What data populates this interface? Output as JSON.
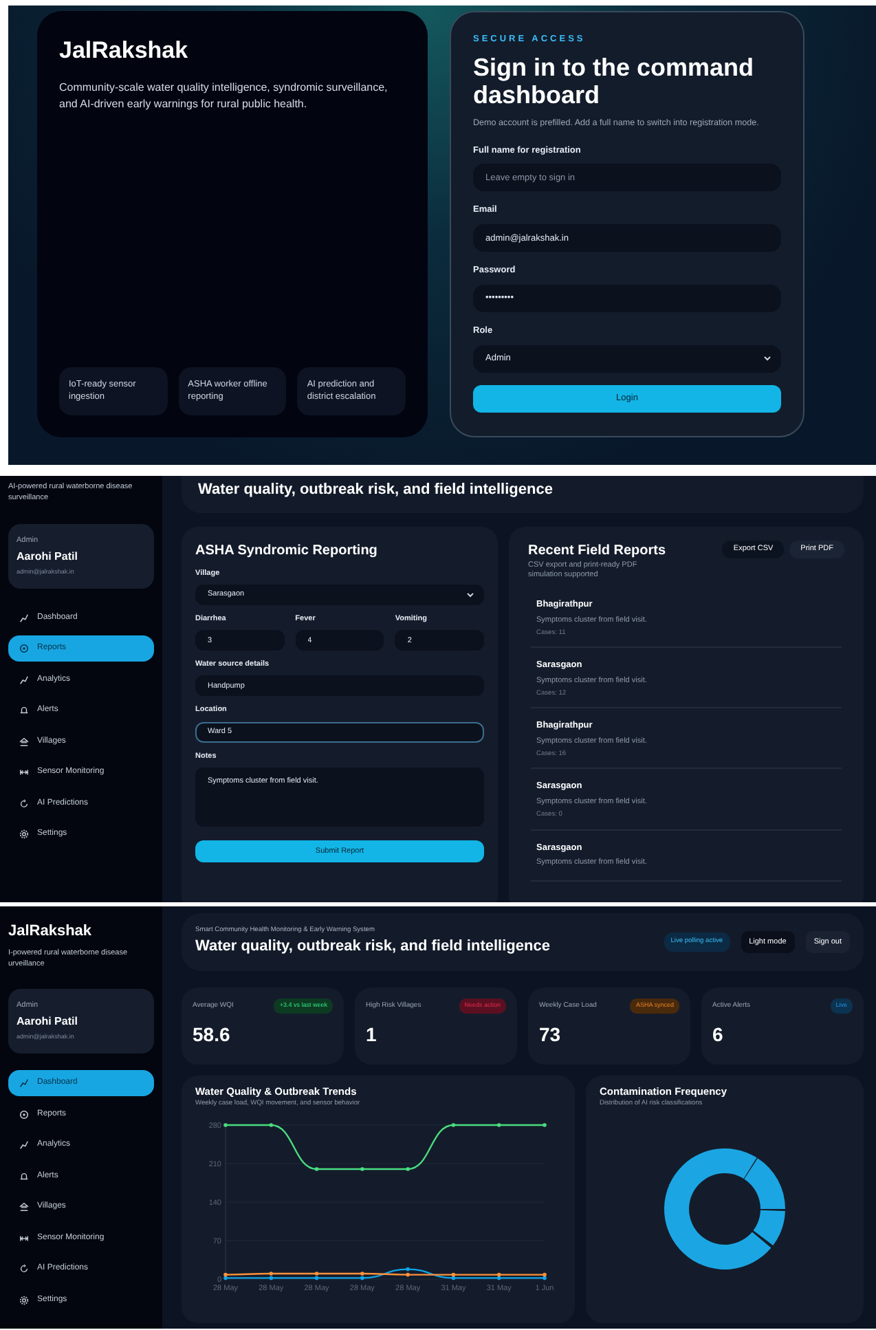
{
  "login_screen": {
    "brand": "JalRakshak",
    "tagline": "Community-scale water quality intelligence, syndromic surveillance, and AI-driven early warnings for rural public health.",
    "features": [
      "IoT-ready sensor ingestion",
      "ASHA worker offline reporting",
      "AI prediction and district escalation"
    ],
    "access_label": "SECURE ACCESS",
    "title": "Sign in to the command dashboard",
    "hint": "Demo account is prefilled. Add a full name to switch into registration mode.",
    "fields": [
      {
        "kind": "text",
        "label": "Full name for registration",
        "placeholder": "Leave empty to sign in"
      },
      {
        "kind": "text",
        "label": "Email",
        "value": "admin@jalrakshak.in"
      },
      {
        "kind": "text",
        "label": "Password",
        "value": "•••••••••"
      },
      {
        "kind": "select",
        "label": "Role",
        "value": "Admin"
      }
    ],
    "submit": "Login"
  },
  "reports_screen": {
    "sidebar": {
      "subtitle": "AI-powered rural waterborne disease surveillance",
      "user": {
        "role": "Admin",
        "name": "Aarohi Patil",
        "email": "admin@jalrakshak.in"
      },
      "nav": [
        {
          "label": "Dashboard",
          "selected": false
        },
        {
          "label": "Reports",
          "selected": true
        },
        {
          "label": "Analytics",
          "selected": false
        },
        {
          "label": "Alerts",
          "selected": false
        },
        {
          "label": "Villages",
          "selected": false
        },
        {
          "label": "Sensor Monitoring",
          "selected": false
        },
        {
          "label": "AI Predictions",
          "selected": false
        },
        {
          "label": "Settings",
          "selected": false
        }
      ]
    },
    "header_title": "Water quality, outbreak risk, and field intelligence",
    "form": {
      "title": "ASHA Syndromic Reporting",
      "fields": [
        {
          "kind": "select",
          "label": "Village",
          "value": "Sarasgaon"
        },
        {
          "kind": "counts",
          "items": [
            {
              "label": "Diarrhea",
              "value": "3"
            },
            {
              "label": "Fever",
              "value": "4"
            },
            {
              "label": "Vomiting",
              "value": "2"
            }
          ]
        },
        {
          "kind": "text",
          "label": "Water source details",
          "value": "Handpump",
          "focused": false
        },
        {
          "kind": "text",
          "label": "Location",
          "value": "Ward 5",
          "focused": true
        },
        {
          "kind": "textarea",
          "label": "Notes",
          "value": "Symptoms cluster from field visit."
        }
      ],
      "submit": "Submit Report"
    },
    "recent": {
      "title": "Recent Field Reports",
      "subtitle": "CSV export and print-ready PDF simulation supported",
      "buttons": [
        "Export CSV",
        "Print PDF"
      ],
      "items": [
        {
          "village": "Bhagirathpur",
          "note": "Symptoms cluster from field visit.",
          "cases": "Cases: 11"
        },
        {
          "village": "Sarasgaon",
          "note": "Symptoms cluster from field visit.",
          "cases": "Cases: 12"
        },
        {
          "village": "Bhagirathpur",
          "note": "Symptoms cluster from field visit.",
          "cases": "Cases: 16"
        },
        {
          "village": "Sarasgaon",
          "note": "Symptoms cluster from field visit.",
          "cases": "Cases: 0"
        },
        {
          "village": "Sarasgaon",
          "note": "Symptoms cluster from field visit."
        }
      ]
    }
  },
  "dashboard_screen": {
    "sidebar": {
      "brand": "JalRakshak",
      "subtitle": "I-powered rural waterborne disease urveillance",
      "user": {
        "role": "Admin",
        "name": "Aarohi Patil",
        "email": "admin@jalrakshak.in"
      },
      "nav": [
        {
          "label": "Dashboard",
          "selected": true
        },
        {
          "label": "Reports",
          "selected": false
        },
        {
          "label": "Analytics",
          "selected": false
        },
        {
          "label": "Alerts",
          "selected": false
        },
        {
          "label": "Villages",
          "selected": false
        },
        {
          "label": "Sensor Monitoring",
          "selected": false
        },
        {
          "label": "AI Predictions",
          "selected": false
        },
        {
          "label": "Settings",
          "selected": false
        }
      ]
    },
    "header": {
      "eyebrow": "Smart Community Health Monitoring & Early Warning System",
      "title": "Water quality, outbreak risk, and field intelligence",
      "status": "Live polling active",
      "buttons": [
        "Light mode",
        "Sign out"
      ]
    },
    "stats": [
      {
        "label": "Average WQI",
        "badge": "+3.4 vs last week",
        "color": "#0d3b22",
        "value": "58.6"
      },
      {
        "label": "High Risk Villages",
        "badge": "Needs action",
        "color": "#5a1020",
        "value": "1"
      },
      {
        "label": "Weekly Case Load",
        "badge": "ASHA synced",
        "color": "#4a2a0c",
        "value": "73"
      },
      {
        "label": "Active Alerts",
        "badge": "Live",
        "color": "#0c3350",
        "value": "6"
      }
    ],
    "trends": {
      "title": "Water Quality & Outbreak Trends",
      "subtitle": "Weekly case load, WQI movement, and sensor behavior",
      "chart_data": {
        "type": "line",
        "categories": [
          "28 May",
          "28 May",
          "28 May",
          "28 May",
          "28 May",
          "31 May",
          "31 May",
          "1 Jun"
        ],
        "ylim": [
          0,
          280
        ],
        "grid": true,
        "yticks": [
          0,
          70,
          140,
          210,
          280
        ],
        "series": [
          {
            "color": "#4ade80",
            "values": [
              280,
              280,
              200,
              200,
              200,
              280,
              280,
              280
            ]
          },
          {
            "color": "#0ea5e9",
            "values": [
              2,
              2,
              2,
              2,
              18,
              2,
              2,
              2
            ]
          },
          {
            "color": "#fb923c",
            "values": [
              8,
              10,
              10,
              10,
              8,
              8,
              8,
              8
            ]
          }
        ]
      }
    },
    "contamination": {
      "title": "Contamination Frequency",
      "subtitle": "Distribution of AI risk classifications"
    }
  }
}
